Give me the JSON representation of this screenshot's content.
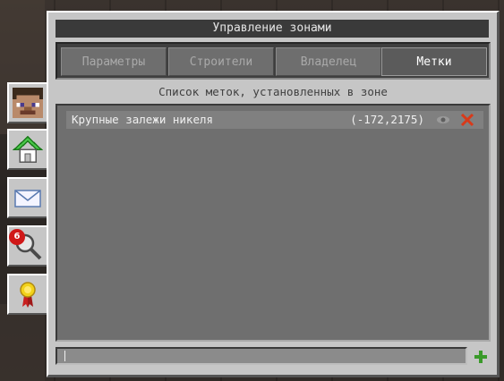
{
  "title": "Управление зонами",
  "tabs": [
    {
      "label": "Параметры",
      "active": false
    },
    {
      "label": "Строители",
      "active": false
    },
    {
      "label": "Владелец",
      "active": false
    },
    {
      "label": "Метки",
      "active": true
    }
  ],
  "list_caption": "Список меток, установленных в зоне",
  "marks": [
    {
      "name": "Крупные залежи никеля",
      "coords": "(-172,2175)"
    }
  ],
  "side_tabs": [
    {
      "icon": "player-head-icon"
    },
    {
      "icon": "home-icon",
      "active": true
    },
    {
      "icon": "envelope-icon"
    },
    {
      "icon": "magnifier-icon",
      "badge": "6"
    },
    {
      "icon": "medal-icon"
    }
  ],
  "input": {
    "value": ""
  },
  "colors": {
    "accent_green": "#3a9a2a",
    "delete_red": "#d83a1a"
  }
}
